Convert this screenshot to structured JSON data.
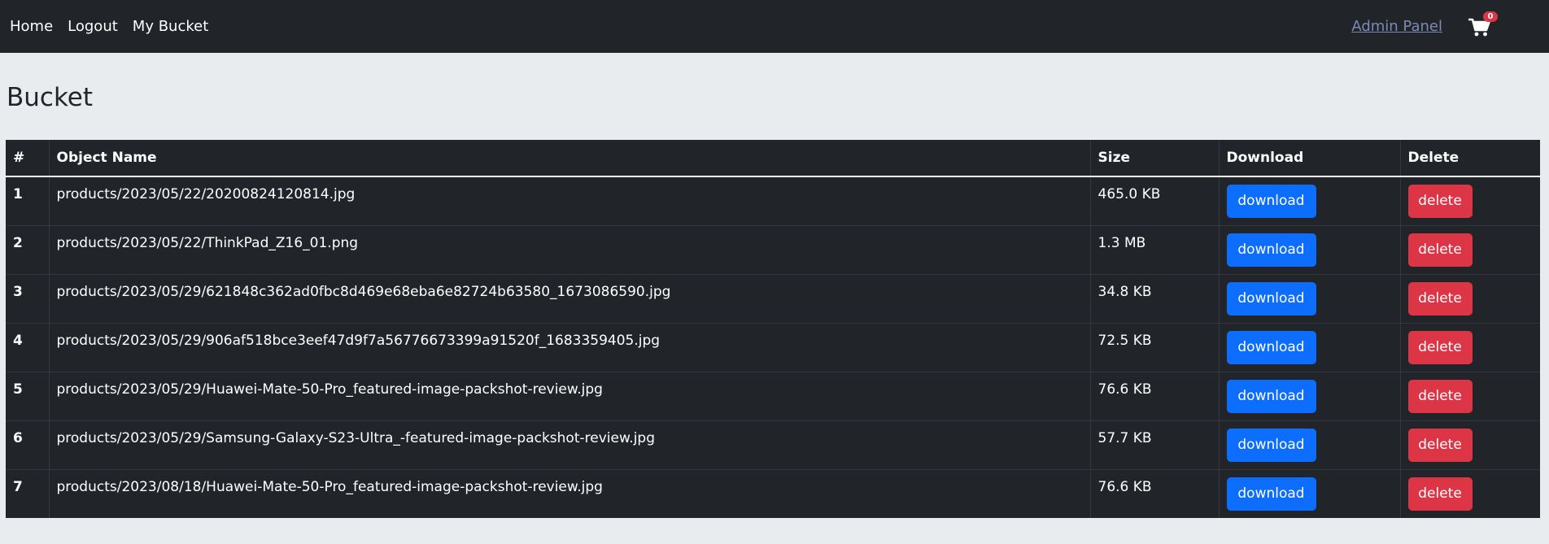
{
  "nav": {
    "home": "Home",
    "logout": "Logout",
    "my_bucket": "My Bucket",
    "admin_panel": "Admin Panel",
    "cart_count": "0",
    "cart_icon": "shopping-cart-icon"
  },
  "page": {
    "title": "Bucket"
  },
  "table": {
    "headers": {
      "index": "#",
      "name": "Object Name",
      "size": "Size",
      "download": "Download",
      "delete": "Delete"
    },
    "download_label": "download",
    "delete_label": "delete",
    "rows": [
      {
        "index": "1",
        "name": "products/2023/05/22/20200824120814.jpg",
        "size": "465.0 KB"
      },
      {
        "index": "2",
        "name": "products/2023/05/22/ThinkPad_Z16_01.png",
        "size": "1.3 MB"
      },
      {
        "index": "3",
        "name": "products/2023/05/29/621848c362ad0fbc8d469e68eba6e82724b63580_1673086590.jpg",
        "size": "34.8 KB"
      },
      {
        "index": "4",
        "name": "products/2023/05/29/906af518bce3eef47d9f7a56776673399a91520f_1683359405.jpg",
        "size": "72.5 KB"
      },
      {
        "index": "5",
        "name": "products/2023/05/29/Huawei-Mate-50-Pro_featured-image-packshot-review.jpg",
        "size": "76.6 KB"
      },
      {
        "index": "6",
        "name": "products/2023/05/29/Samsung-Galaxy-S23-Ultra_-featured-image-packshot-review.jpg",
        "size": "57.7 KB"
      },
      {
        "index": "7",
        "name": "products/2023/08/18/Huawei-Mate-50-Pro_featured-image-packshot-review.jpg",
        "size": "76.6 KB"
      }
    ]
  },
  "colors": {
    "navbar": "#212529",
    "download_button": "#0d6efd",
    "delete_button": "#dc3545",
    "page_background": "#e9ecef"
  }
}
